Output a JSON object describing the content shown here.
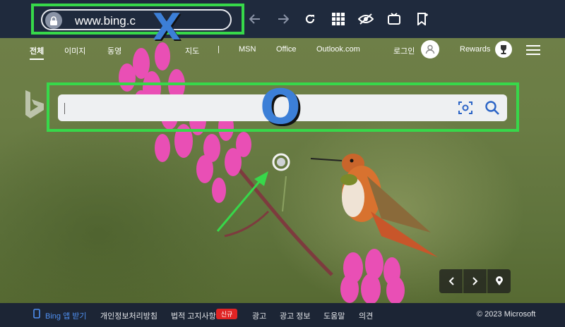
{
  "browser": {
    "url": "www.bing.c",
    "overlay_x": "X"
  },
  "nav": {
    "items": [
      "전체",
      "이미지",
      "동영",
      "지도",
      "|",
      "MSN",
      "Office",
      "Outlook.com"
    ],
    "login_label": "로그인",
    "rewards_label": "Rewards"
  },
  "search": {
    "value": "",
    "overlay_o": "O"
  },
  "footer": {
    "app_link": "Bing 앱 받기",
    "items": [
      "개인정보처리방침",
      "법적 고지사항",
      "광고",
      "광고 정보",
      "도움말",
      "의견"
    ],
    "new_badge": "신규",
    "copyright": "© 2023 Microsoft"
  },
  "colors": {
    "annotation_green": "#37d84a",
    "annotation_blue": "#3c7fd7",
    "toolbar_bg": "#1f2a3d",
    "footer_bg": "#1c2535"
  }
}
